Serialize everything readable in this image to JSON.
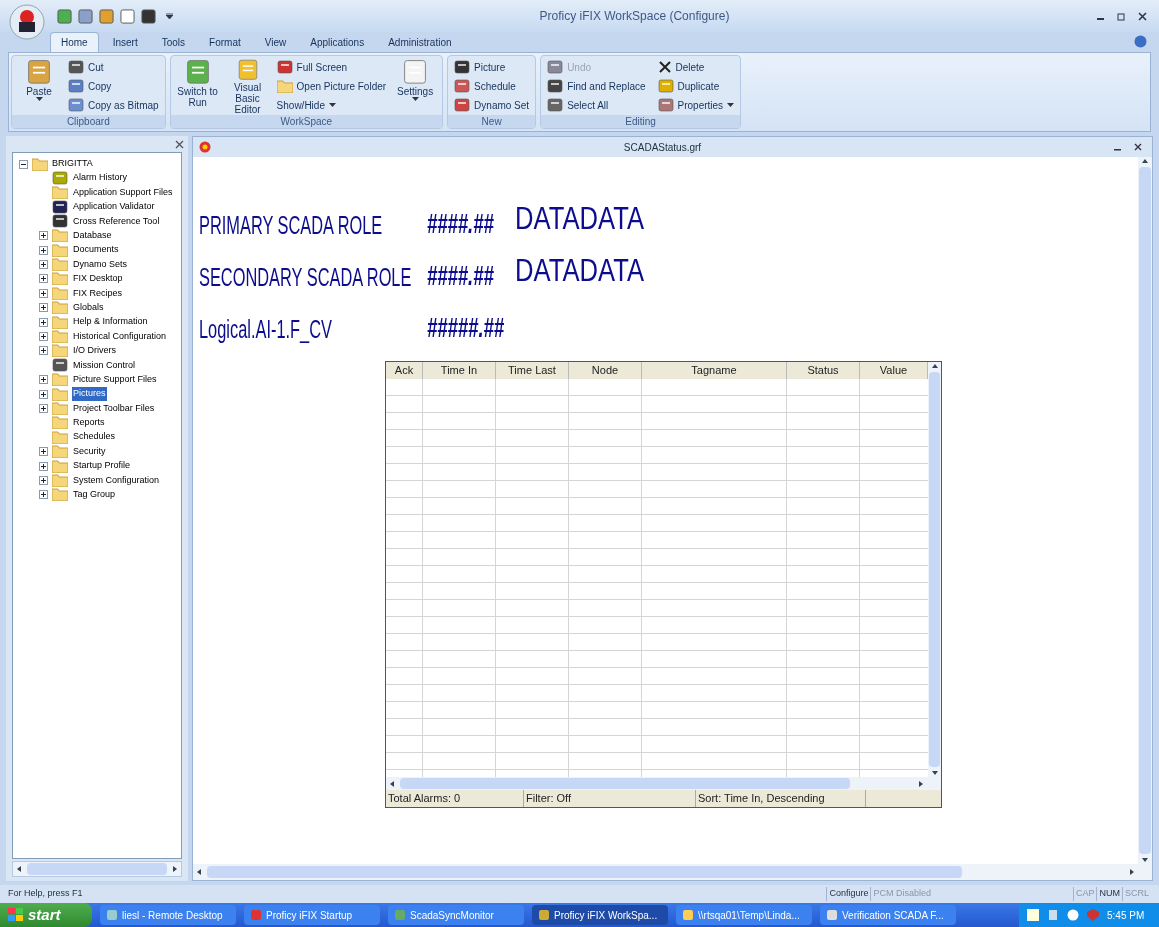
{
  "window": {
    "title": "Proficy iFIX WorkSpace (Configure)"
  },
  "tabs": [
    {
      "label": "Home",
      "selected": true
    },
    {
      "label": "Insert",
      "selected": false
    },
    {
      "label": "Tools",
      "selected": false
    },
    {
      "label": "Format",
      "selected": false
    },
    {
      "label": "View",
      "selected": false
    },
    {
      "label": "Applications",
      "selected": false
    },
    {
      "label": "Administration",
      "selected": false
    }
  ],
  "ribbon": [
    {
      "label": "Clipboard",
      "large": [
        {
          "label": "Paste",
          "dropdown": true
        }
      ],
      "small": [
        {
          "label": "Cut",
          "disabled": false
        },
        {
          "label": "Copy",
          "disabled": false
        },
        {
          "label": "Copy as Bitmap",
          "disabled": false
        }
      ]
    },
    {
      "label": "WorkSpace",
      "large": [
        {
          "label": "Switch to Run",
          "dropdown": false
        },
        {
          "label": "Visual Basic Editor",
          "dropdown": false
        }
      ],
      "small": [
        {
          "label": "Full Screen",
          "disabled": false
        },
        {
          "label": "Open Picture Folder",
          "disabled": false
        },
        {
          "label": "Show/Hide",
          "disabled": false,
          "dropdown": true
        }
      ],
      "large_after": [
        {
          "label": "Settings",
          "dropdown": true
        }
      ]
    },
    {
      "label": "New",
      "small": [
        {
          "label": "Picture",
          "disabled": false
        },
        {
          "label": "Schedule",
          "disabled": false
        },
        {
          "label": "Dynamo Set",
          "disabled": false
        }
      ]
    },
    {
      "label": "Editing",
      "small": [
        {
          "label": "Undo",
          "disabled": true
        },
        {
          "label": "Find and Replace",
          "disabled": false
        },
        {
          "label": "Select All",
          "disabled": false
        },
        {
          "label": "Delete",
          "disabled": false
        },
        {
          "label": "Duplicate",
          "disabled": false
        },
        {
          "label": "Properties",
          "disabled": false,
          "dropdown": true
        }
      ]
    }
  ],
  "tree": {
    "label": "BRIGITTA",
    "expanded": true,
    "children": [
      {
        "label": "Alarm History",
        "kind": "history",
        "selected": false
      },
      {
        "label": "Application Support Files",
        "kind": "folder",
        "selected": false
      },
      {
        "label": "Application Validator",
        "kind": "validator",
        "selected": false
      },
      {
        "label": "Cross Reference Tool",
        "kind": "reference",
        "selected": false
      },
      {
        "label": "Database",
        "kind": "folder",
        "expanded": false,
        "selected": false
      },
      {
        "label": "Documents",
        "kind": "folder",
        "expanded": false,
        "selected": false
      },
      {
        "label": "Dynamo Sets",
        "kind": "folder",
        "expanded": false,
        "selected": false
      },
      {
        "label": "FIX Desktop",
        "kind": "folder",
        "expanded": false,
        "selected": false
      },
      {
        "label": "FIX Recipes",
        "kind": "folder",
        "expanded": false,
        "selected": false
      },
      {
        "label": "Globals",
        "kind": "folder",
        "expanded": false,
        "selected": false
      },
      {
        "label": "Help & Information",
        "kind": "folder",
        "expanded": false,
        "selected": false
      },
      {
        "label": "Historical Configuration",
        "kind": "folder",
        "expanded": false,
        "selected": false
      },
      {
        "label": "I/O Drivers",
        "kind": "folder",
        "expanded": false,
        "selected": false
      },
      {
        "label": "Mission Control",
        "kind": "mission",
        "selected": false
      },
      {
        "label": "Picture Support Files",
        "kind": "folder",
        "expanded": false,
        "selected": false
      },
      {
        "label": "Pictures",
        "kind": "folder",
        "expanded": false,
        "selected": true
      },
      {
        "label": "Project Toolbar Files",
        "kind": "folder",
        "expanded": false,
        "selected": false
      },
      {
        "label": "Reports",
        "kind": "folder",
        "selected": false
      },
      {
        "label": "Schedules",
        "kind": "folder",
        "selected": false
      },
      {
        "label": "Security",
        "kind": "folder",
        "expanded": false,
        "selected": false
      },
      {
        "label": "Startup Profile",
        "kind": "folder",
        "expanded": false,
        "selected": false
      },
      {
        "label": "System Configuration",
        "kind": "folder",
        "expanded": false,
        "selected": false
      },
      {
        "label": "Tag Group",
        "kind": "folder",
        "expanded": false,
        "selected": false
      }
    ]
  },
  "document": {
    "title": "SCADAStatus.grf",
    "fields": [
      {
        "label": "PRIMARY SCADA ROLE",
        "value": "####.##",
        "text": "DATADATA"
      },
      {
        "label": "SECONDARY SCADA ROLE",
        "value": "####.##",
        "text": "DATADATA"
      },
      {
        "label": "Logical.AI-1.F_CV",
        "value": "#####.##"
      }
    ],
    "alarm_table": {
      "columns": [
        "Ack",
        "Time In",
        "Time Last",
        "Node",
        "Tagname",
        "Status",
        "Value"
      ],
      "footer": [
        "Total Alarms: 0",
        "Filter: Off",
        "Sort: Time In, Descending"
      ]
    }
  },
  "status_bar": {
    "help": "For Help, press F1",
    "panes": [
      {
        "label": "Configure",
        "disabled": false
      },
      {
        "label": "PCM Disabled",
        "disabled": true
      },
      {
        "label": "CAP",
        "disabled": true
      },
      {
        "label": "NUM",
        "disabled": false
      },
      {
        "label": "SCRL",
        "disabled": true
      }
    ]
  },
  "taskbar": {
    "start": "start",
    "tasks": [
      {
        "label": "liesl - Remote Desktop",
        "selected": false
      },
      {
        "label": "Proficy iFIX Startup",
        "selected": false
      },
      {
        "label": "ScadaSyncMonitor",
        "selected": false
      },
      {
        "label": "Proficy iFIX WorkSpa...",
        "selected": true
      },
      {
        "label": "\\\\rtsqa01\\Temp\\Linda...",
        "selected": false
      },
      {
        "label": "Verification SCADA F...",
        "selected": false
      }
    ],
    "clock": "5:45 PM"
  }
}
